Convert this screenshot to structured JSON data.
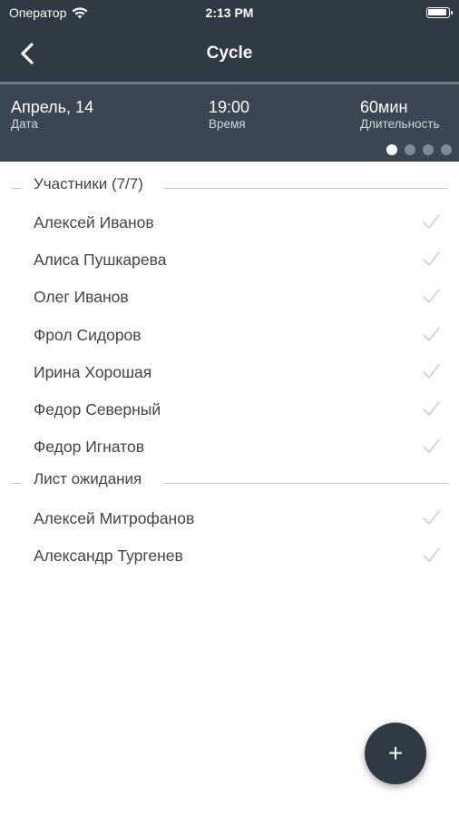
{
  "status": {
    "carrier": "Оператор",
    "time": "2:13 PM"
  },
  "nav": {
    "title": "Cycle"
  },
  "info": {
    "date_value": "Апрель, 14",
    "date_label": "Дата",
    "time_value": "19:00",
    "time_label": "Время",
    "duration_value": "60мин",
    "duration_label": "Длительность",
    "page_count": 4,
    "page_active": 1
  },
  "participants": {
    "title": "Участники (7/7)",
    "items": [
      {
        "name": "Алексей Иванов",
        "checked": true
      },
      {
        "name": "Алиса Пушкарева",
        "checked": true
      },
      {
        "name": "Олег Иванов",
        "checked": true
      },
      {
        "name": "Фрол Сидоров",
        "checked": true
      },
      {
        "name": "Ирина Хорошая",
        "checked": true
      },
      {
        "name": "Федор Северный",
        "checked": true
      },
      {
        "name": "Федор Игнатов",
        "checked": true
      }
    ]
  },
  "waitlist": {
    "title": "Лист ожидания",
    "items": [
      {
        "name": "Алексей Митрофанов",
        "checked": true
      },
      {
        "name": "Александр Тургенев",
        "checked": true
      }
    ]
  },
  "fab": {
    "label": "+"
  },
  "colors": {
    "header": "#2f3a44",
    "infobar": "#3a4652",
    "check": "#cfcfcf"
  }
}
